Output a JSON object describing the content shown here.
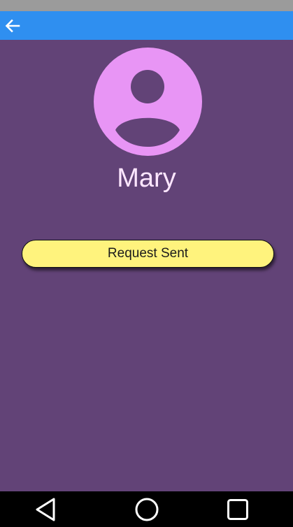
{
  "colors": {
    "status_bar": "#9b9b9b",
    "app_bar": "#2f8ff0",
    "background": "#624377",
    "avatar": "#e895f5",
    "avatar_figure": "#624377",
    "name_text": "#fde6ff",
    "request_button": "#fff37d",
    "nav_bar": "#000000",
    "nav_icons": "#ffffff"
  },
  "app_bar": {
    "back_icon": "arrow-left-icon"
  },
  "profile": {
    "avatar_icon": "account-circle-icon",
    "name": "Mary"
  },
  "actions": {
    "request_label": "Request Sent"
  },
  "nav_bar": {
    "icons": [
      "back-triangle-icon",
      "home-circle-icon",
      "recents-square-icon"
    ]
  }
}
